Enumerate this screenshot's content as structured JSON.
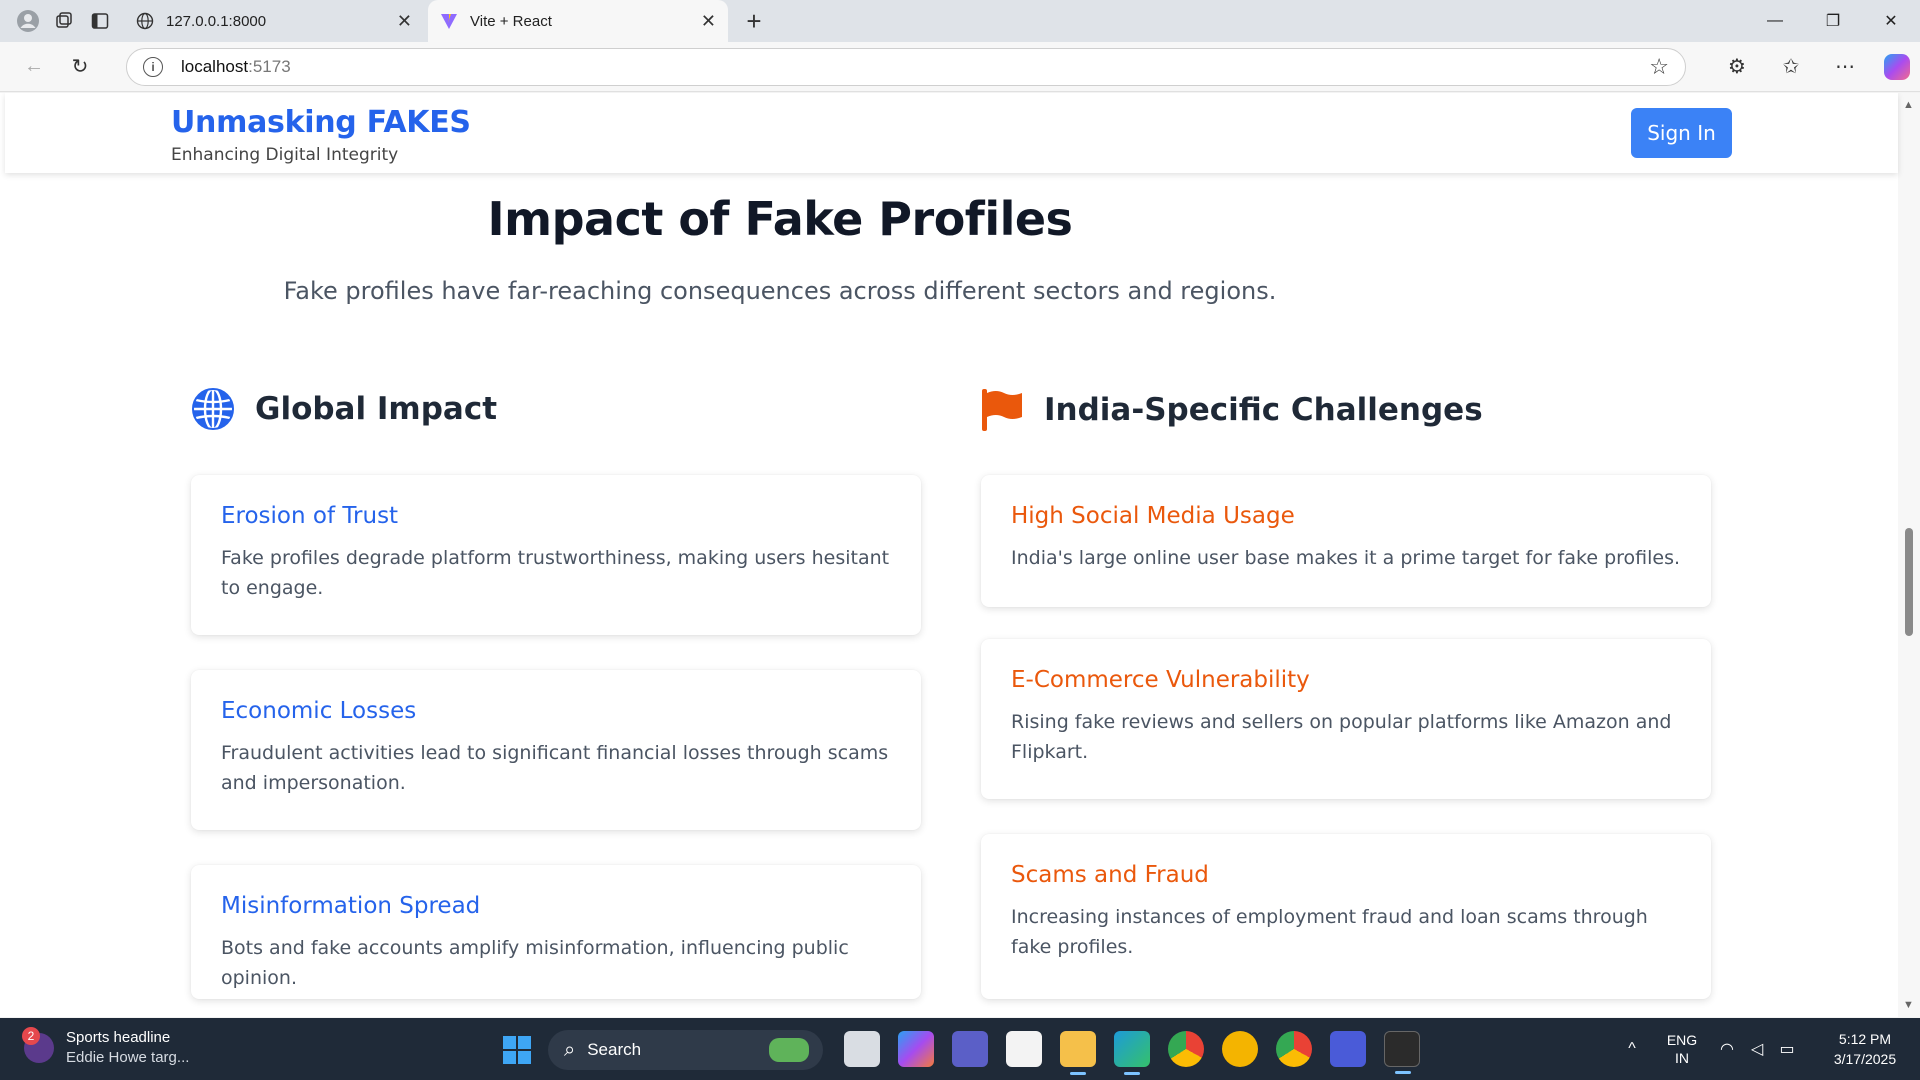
{
  "browser": {
    "tabs": [
      {
        "title": "127.0.0.1:8000",
        "active": false
      },
      {
        "title": "Vite + React",
        "active": true
      }
    ],
    "url_host": "localhost",
    "url_port": ":5173"
  },
  "header": {
    "title": "Unmasking FAKES",
    "subtitle": "Enhancing Digital Integrity",
    "signin_label": "Sign In"
  },
  "section": {
    "title": "Impact of Fake Profiles",
    "subtitle": "Fake profiles have far-reaching consequences across different sectors and regions."
  },
  "global": {
    "heading": "Global Impact",
    "icon": "globe-icon",
    "color": "#2563eb",
    "items": [
      {
        "title": "Erosion of Trust",
        "text": "Fake profiles degrade platform trustworthiness, making users hesitant to engage."
      },
      {
        "title": "Economic Losses",
        "text": "Fraudulent activities lead to significant financial losses through scams and impersonation."
      },
      {
        "title": "Misinformation Spread",
        "text": "Bots and fake accounts amplify misinformation, influencing public opinion."
      }
    ]
  },
  "india": {
    "heading": "India-Specific Challenges",
    "icon": "flag-icon",
    "color": "#ea580c",
    "items": [
      {
        "title": "High Social Media Usage",
        "text": "India's large online user base makes it a prime target for fake profiles."
      },
      {
        "title": "E-Commerce Vulnerability",
        "text": "Rising fake reviews and sellers on popular platforms like Amazon and Flipkart."
      },
      {
        "title": "Scams and Fraud",
        "text": "Increasing instances of employment fraud and loan scams through fake profiles."
      }
    ]
  },
  "taskbar": {
    "news_badge": "2",
    "news_title": "Sports headline",
    "news_sub": "Eddie Howe targ...",
    "search_label": "Search",
    "lang_1": "ENG",
    "lang_2": "IN",
    "time": "5:12 PM",
    "date": "3/17/2025"
  }
}
